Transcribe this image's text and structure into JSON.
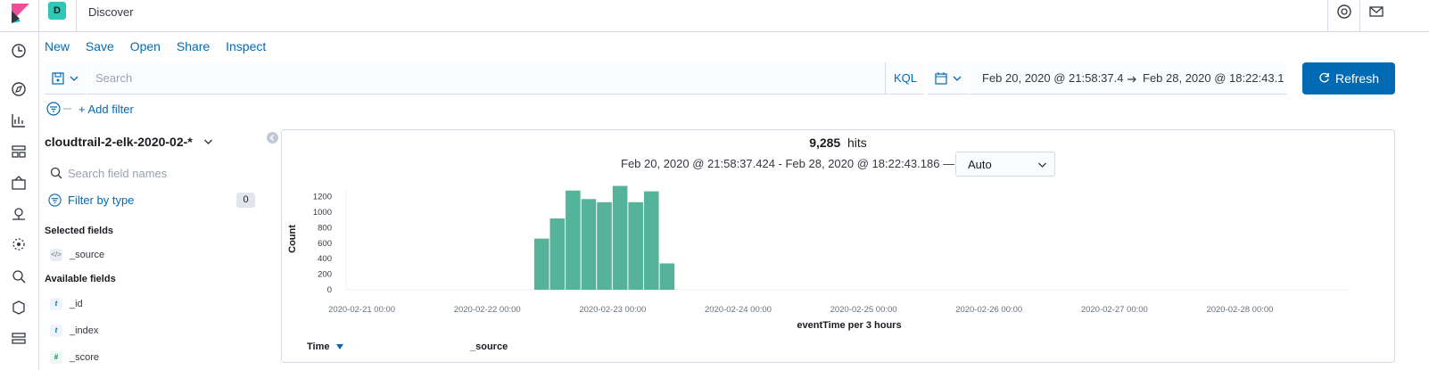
{
  "header": {
    "space_initial": "D",
    "breadcrumb": "Discover"
  },
  "menu": {
    "items": [
      "New",
      "Save",
      "Open",
      "Share",
      "Inspect"
    ]
  },
  "query": {
    "placeholder": "Search",
    "language": "KQL",
    "date_from": "Feb 20, 2020 @ 21:58:37.4",
    "date_to": "Feb 28, 2020 @ 18:22:43.1",
    "refresh_label": "Refresh"
  },
  "filters": {
    "add_label": "+ Add filter"
  },
  "sidebar": {
    "index_pattern": "cloudtrail-2-elk-2020-02-*",
    "search_placeholder": "Search field names",
    "filter_by_type": "Filter by type",
    "filter_count": "0",
    "selected_title": "Selected fields",
    "selected": [
      {
        "type": "</>",
        "name": "_source"
      }
    ],
    "available_title": "Available fields",
    "available": [
      {
        "type": "t",
        "name": "_id"
      },
      {
        "type": "t",
        "name": "_index"
      },
      {
        "type": "#",
        "name": "_score"
      }
    ]
  },
  "results": {
    "hits": "9,285",
    "hits_label": "hits",
    "range": "Feb 20, 2020 @ 21:58:37.424 - Feb 28, 2020 @ 18:22:43.186 —",
    "interval": "Auto"
  },
  "table": {
    "columns": [
      "Time",
      "_source"
    ]
  },
  "colors": {
    "accent": "#006bb4",
    "bar": "#54b399"
  },
  "chart_data": {
    "type": "bar",
    "xlabel": "eventTime per 3 hours",
    "ylabel": "Count",
    "ylim": [
      0,
      1300
    ],
    "yticks": [
      0,
      200,
      400,
      600,
      800,
      1000,
      1200
    ],
    "xticks": [
      "2020-02-21 00:00",
      "2020-02-22 00:00",
      "2020-02-23 00:00",
      "2020-02-24 00:00",
      "2020-02-25 00:00",
      "2020-02-26 00:00",
      "2020-02-27 00:00",
      "2020-02-28 00:00"
    ],
    "x": [
      "2020-02-22 09:00",
      "2020-02-22 12:00",
      "2020-02-22 15:00",
      "2020-02-22 18:00",
      "2020-02-22 21:00",
      "2020-02-23 00:00",
      "2020-02-23 03:00",
      "2020-02-23 06:00",
      "2020-02-23 09:00"
    ],
    "values": [
      660,
      920,
      1280,
      1170,
      1130,
      1340,
      1130,
      1270,
      340
    ]
  }
}
